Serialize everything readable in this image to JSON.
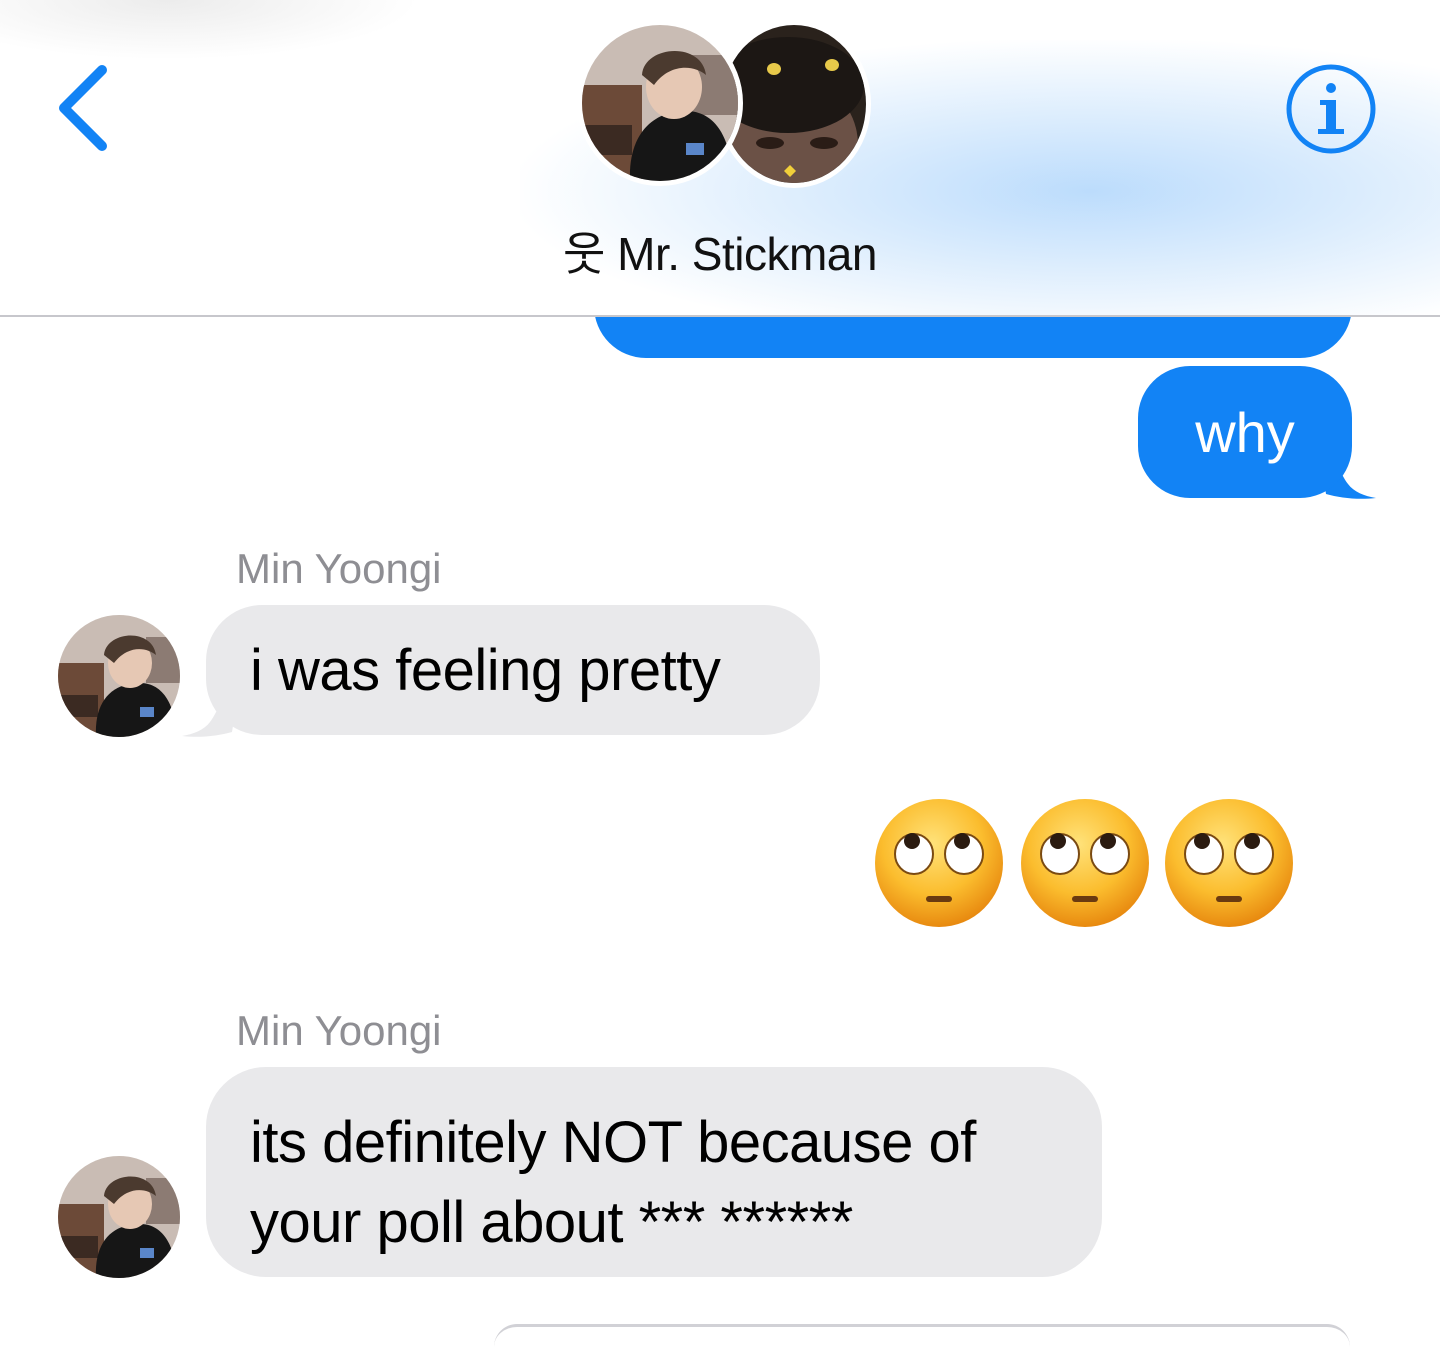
{
  "header": {
    "contact_name": "웃 Mr. Stickman",
    "back_icon": "chevron-left-icon",
    "info_icon": "info-circle-icon",
    "accent_color": "#1283f5"
  },
  "messages": [
    {
      "direction": "outgoing",
      "text": ""
    },
    {
      "direction": "outgoing",
      "text": "why"
    },
    {
      "direction": "incoming",
      "sender": "Min Yoongi",
      "text": "i was feeling pretty"
    },
    {
      "direction": "outgoing",
      "text": "🙄🙄🙄",
      "emoji_name": "face-with-rolling-eyes"
    },
    {
      "direction": "incoming",
      "sender": "Min Yoongi",
      "text": "its definitely NOT because of your poll about *** ******"
    }
  ],
  "colors": {
    "outgoing_bubble": "#1283f5",
    "incoming_bubble": "#e9e9eb",
    "sender_name": "#8e8e93"
  }
}
